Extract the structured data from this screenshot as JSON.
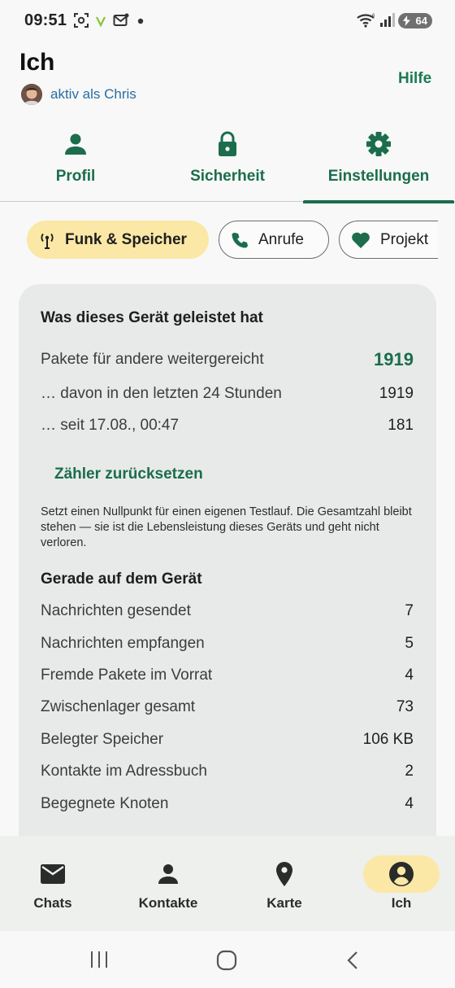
{
  "status_bar": {
    "time": "09:51",
    "battery": "64"
  },
  "header": {
    "title": "Ich",
    "subtitle": "aktiv als Chris",
    "help": "Hilfe"
  },
  "tabs": [
    {
      "label": "Profil",
      "icon": "person-icon"
    },
    {
      "label": "Sicherheit",
      "icon": "lock-icon"
    },
    {
      "label": "Einstellungen",
      "icon": "gear-icon",
      "active": true
    }
  ],
  "chips": [
    {
      "label": "Funk & Speicher",
      "icon": "antenna-icon",
      "active": true
    },
    {
      "label": "Anrufe",
      "icon": "phone-icon"
    },
    {
      "label": "Projekt",
      "icon": "heart-icon"
    }
  ],
  "card": {
    "section1_title": "Was dieses Gerät geleistet hat",
    "stats": [
      {
        "label": "Pakete für andere weitergereicht",
        "value": "1919"
      },
      {
        "label": "… davon in den letzten 24 Stunden",
        "value": "1919"
      },
      {
        "label": "… seit 17.08., 00:47",
        "value": "181"
      }
    ],
    "reset_label": "Zähler zurücksetzen",
    "note": "Setzt einen Nullpunkt für einen eigenen Testlauf. Die Gesamtzahl bleibt stehen — sie ist die Lebensleistung dieses Geräts und geht nicht verloren.",
    "section2_title": "Gerade auf dem Gerät",
    "device": [
      {
        "label": "Nachrichten gesendet",
        "value": "7"
      },
      {
        "label": "Nachrichten empfangen",
        "value": "5"
      },
      {
        "label": "Fremde Pakete im Vorrat",
        "value": "4"
      },
      {
        "label": "Zwischenlager gesamt",
        "value": "73"
      },
      {
        "label": "Belegter Speicher",
        "value": "106 KB"
      },
      {
        "label": "Kontakte im Adressbuch",
        "value": "2"
      },
      {
        "label": "Begegnete Knoten",
        "value": "4"
      }
    ]
  },
  "bottom_nav": [
    {
      "label": "Chats",
      "icon": "mail-icon"
    },
    {
      "label": "Kontakte",
      "icon": "person-icon"
    },
    {
      "label": "Karte",
      "icon": "location-pin-icon"
    },
    {
      "label": "Ich",
      "icon": "account-circle-icon",
      "active": true
    }
  ],
  "colors": {
    "accent": "#1b6d4c",
    "chip_active": "#fbe8a6",
    "link": "#2b6ca3"
  }
}
